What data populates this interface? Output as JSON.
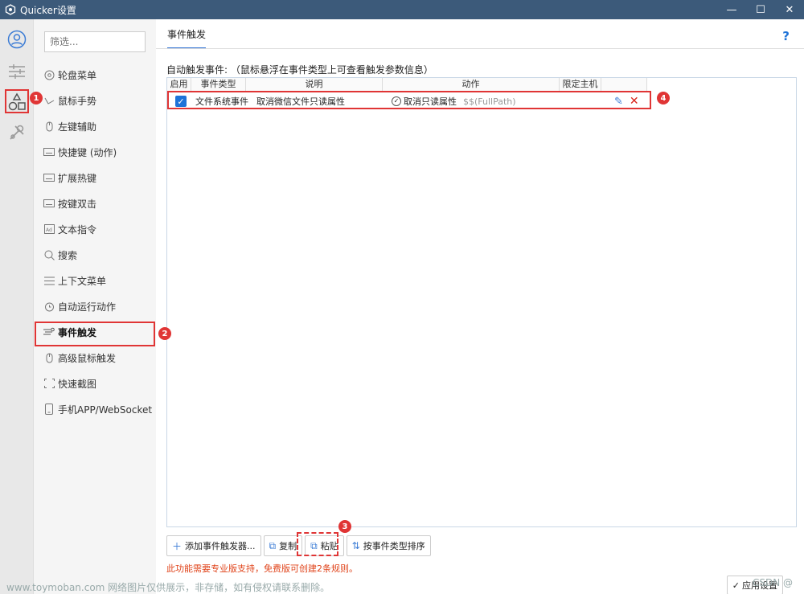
{
  "window": {
    "title": "Quicker设置",
    "minimize": "—",
    "maximize": "☐",
    "close": "✕"
  },
  "filter": {
    "placeholder": "筛选..."
  },
  "nav": {
    "items": [
      {
        "label": "轮盘菜单",
        "icon": "wheel-icon"
      },
      {
        "label": "鼠标手势",
        "icon": "gesture-icon"
      },
      {
        "label": "左键辅助",
        "icon": "mouse-icon"
      },
      {
        "label": "快捷键 (动作)",
        "icon": "keyboard-icon"
      },
      {
        "label": "扩展热键",
        "icon": "keyboard-icon"
      },
      {
        "label": "按键双击",
        "icon": "keyboard-icon"
      },
      {
        "label": "文本指令",
        "icon": "text-command-icon"
      },
      {
        "label": "搜索",
        "icon": "search-icon"
      },
      {
        "label": "上下文菜单",
        "icon": "menu-icon"
      },
      {
        "label": "自动运行动作",
        "icon": "alarm-icon"
      },
      {
        "label": "事件触发",
        "icon": "event-icon"
      },
      {
        "label": "高级鼠标触发",
        "icon": "mouse-icon"
      },
      {
        "label": "快速截图",
        "icon": "screenshot-icon"
      },
      {
        "label": "手机APP/WebSocket",
        "icon": "phone-icon"
      }
    ]
  },
  "main": {
    "tab": "事件触发",
    "help": "?",
    "section_label": "自动触发事件: （鼠标悬浮在事件类型上可查看触发参数信息）",
    "columns": [
      "启用",
      "事件类型",
      "说明",
      "动作",
      "限定主机"
    ],
    "rows": [
      {
        "enabled": true,
        "event_type": "文件系统事件",
        "description": "取消微信文件只读属性",
        "action": "取消只读属性",
        "params": "$$(FullPath)"
      }
    ],
    "toolbar": {
      "add": "添加事件触发器...",
      "copy": "复制",
      "paste": "粘贴",
      "sort": "按事件类型排序"
    },
    "notice": "此功能需要专业版支持，免费版可创建2条规则。",
    "apply": "应用设置"
  },
  "annotations": [
    "1",
    "2",
    "3",
    "4"
  ],
  "watermark": "www.toymoban.com 网络图片仅供展示，非存储，如有侵权请联系删除。",
  "watermark2": "CSDN @",
  "colors": {
    "titlebar": "#3c5a7a",
    "accent": "#1e73d8",
    "annotation": "#e03535",
    "notice": "#e0441b"
  }
}
